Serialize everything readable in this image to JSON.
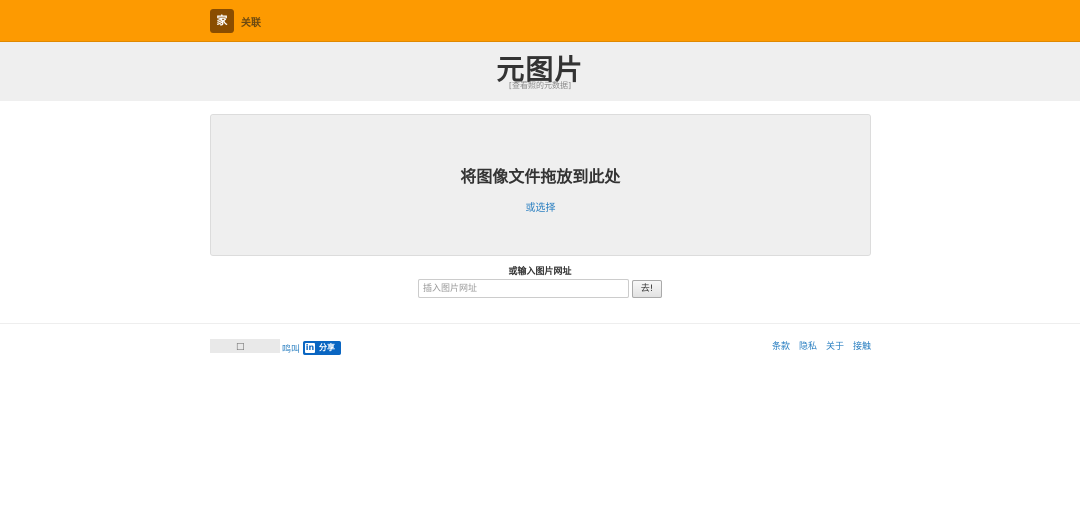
{
  "header": {
    "brand_char": "家",
    "nav_link": "关联"
  },
  "title_band": {
    "title": "元图片",
    "subtitle": "[查看照的元数据]"
  },
  "dropzone": {
    "title": "将图像文件拖放到此处",
    "select_link": "或选择"
  },
  "url_form": {
    "label": "或输入图片网址",
    "placeholder": "插入图片网址",
    "go_label": "去!"
  },
  "footer": {
    "tweet_label": "鸣叫",
    "linkedin_share_label": "分享",
    "links": [
      "条款",
      "隐私",
      "关于",
      "接触"
    ]
  },
  "colors": {
    "topbar": "#fd9a01",
    "brand_bg": "#8a4d00",
    "link": "#2a7fc1",
    "linkedin": "#0a66c2"
  }
}
